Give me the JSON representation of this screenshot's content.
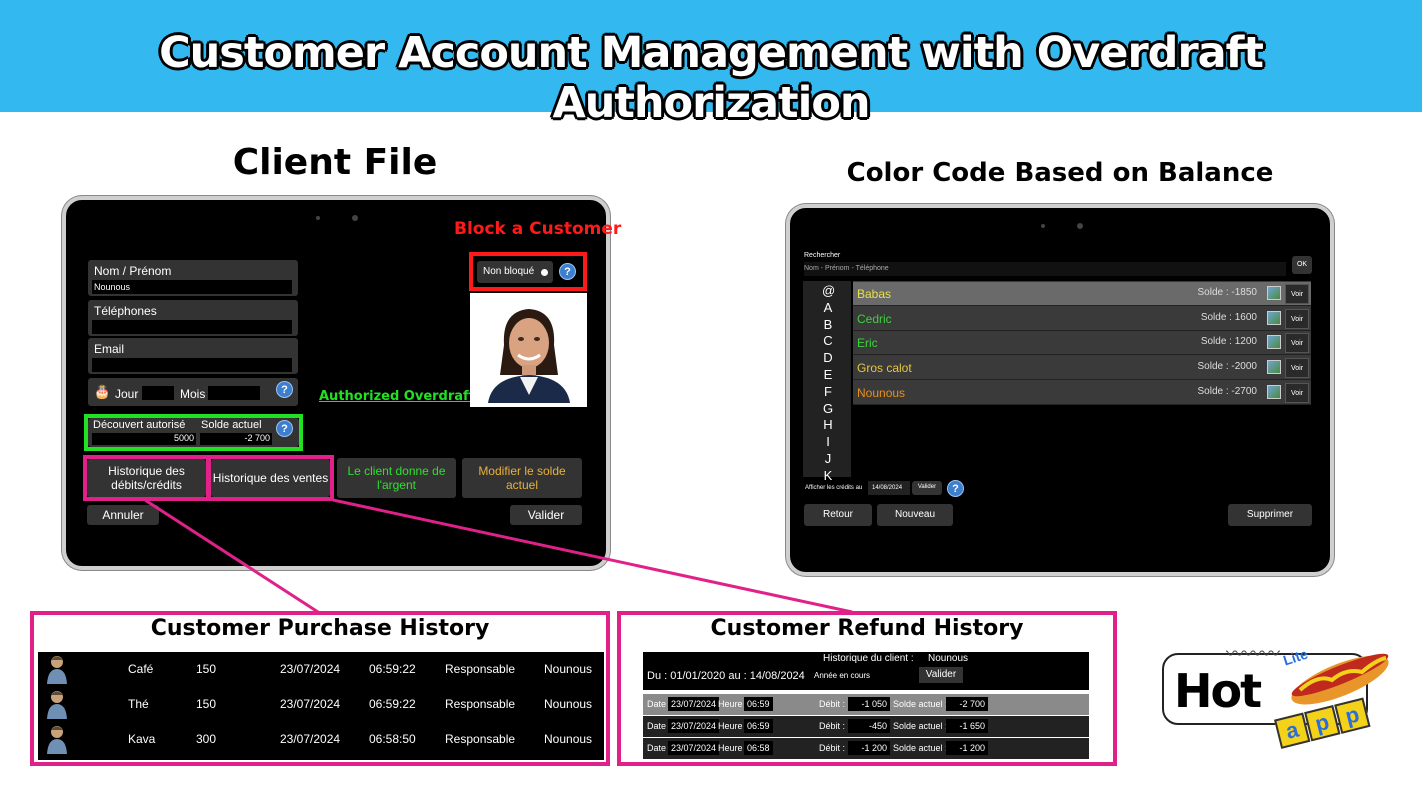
{
  "banner": {
    "title": "Customer Account Management with Overdraft Authorization"
  },
  "client_file": {
    "heading": "Client File",
    "block_callout": "Block a Customer",
    "overdraft_callout": "Authorized Overdraft",
    "name_label": "Nom / Prénom",
    "name_value": "Nounous",
    "phones_label": "Téléphones",
    "email_label": "Email",
    "day_label": "Jour",
    "month_label": "Mois",
    "overdraft_label": "Découvert autorisé",
    "overdraft_value": "5000",
    "balance_label": "Solde actuel",
    "balance_value": "-2 700",
    "blocked_toggle": "Non bloqué",
    "history_debits_credits": "Historique des débits/crédits",
    "history_sales": "Historique des ventes",
    "client_gives_money": "Le client donne de l'argent",
    "modify_balance": "Modifier le solde actuel",
    "cancel": "Annuler",
    "validate": "Valider",
    "help": "?"
  },
  "color_code": {
    "heading": "Color Code Based on Balance",
    "search_label": "Rechercher",
    "search_placeholder": "Nom - Prénom - Téléphone",
    "ok": "OK",
    "letters": [
      "@",
      "A",
      "B",
      "C",
      "D",
      "E",
      "F",
      "G",
      "H",
      "I",
      "J",
      "K"
    ],
    "clients": [
      {
        "name": "Babas",
        "balance": "Solde : -1850",
        "color": "#e8e04a",
        "selected": true
      },
      {
        "name": "Cedric",
        "balance": "Solde : 1600",
        "color": "#3ed13e",
        "selected": false
      },
      {
        "name": "Eric",
        "balance": "Solde : 1200",
        "color": "#3ed13e",
        "selected": false
      },
      {
        "name": "Gros calot",
        "balance": "Solde : -2000",
        "color": "#e8c63a",
        "selected": false
      },
      {
        "name": "Nounous",
        "balance": "Solde : -2700",
        "color": "#e8901e",
        "selected": false
      }
    ],
    "view": "Voir",
    "show_credits_label": "Afficher les crédits au",
    "show_credits_date": "14/08/2024",
    "validate": "Valider",
    "back": "Retour",
    "new": "Nouveau",
    "delete": "Supprimer"
  },
  "purchase_history": {
    "heading": "Customer Purchase History",
    "rows": [
      {
        "item": "Café",
        "amount": "150",
        "date": "23/07/2024",
        "time": "06:59:22",
        "role": "Responsable",
        "client": "Nounous"
      },
      {
        "item": "Thé",
        "amount": "150",
        "date": "23/07/2024",
        "time": "06:59:22",
        "role": "Responsable",
        "client": "Nounous"
      },
      {
        "item": "Kava",
        "amount": "300",
        "date": "23/07/2024",
        "time": "06:58:50",
        "role": "Responsable",
        "client": "Nounous"
      }
    ]
  },
  "refund_history": {
    "heading": "Customer Refund History",
    "title_label": "Historique du client :",
    "title_value": "Nounous",
    "range": "Du : 01/01/2020  au : 14/08/2024",
    "period": "Année en cours",
    "validate": "Valider",
    "date_label": "Date",
    "time_label": "Heure",
    "debit_label": "Débit :",
    "balance_label": "Solde actuel :",
    "rows": [
      {
        "date": "23/07/2024",
        "time": "06:59",
        "debit": "-1 050",
        "balance": "-2 700"
      },
      {
        "date": "23/07/2024",
        "time": "06:59",
        "debit": "-450",
        "balance": "-1 650"
      },
      {
        "date": "23/07/2024",
        "time": "06:58",
        "debit": "-1 200",
        "balance": "-1 200"
      }
    ]
  },
  "logo": {
    "word": "Hot",
    "badge": "Lite",
    "suffix": "app"
  },
  "colors": {
    "banner": "#33b8ef",
    "highlight": "#e0218a",
    "block": "#ff1a1a",
    "overdraft": "#22e022"
  }
}
